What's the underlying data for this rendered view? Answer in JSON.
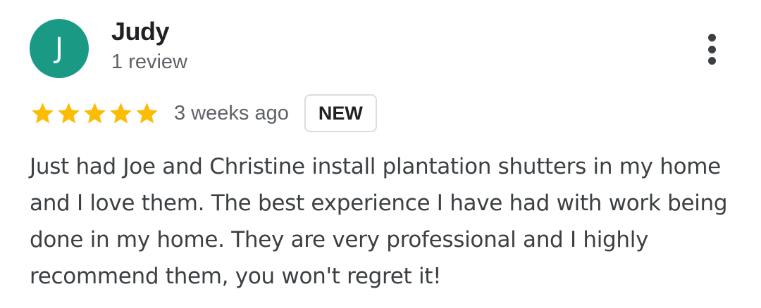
{
  "reviewer": {
    "initial": "J",
    "avatar_color": "#1a9a85",
    "name": "Judy",
    "review_count": "1 review"
  },
  "rating": {
    "stars": 5,
    "max_stars": 5,
    "star_color": "#fbbc04",
    "time_ago": "3 weeks ago",
    "badge": "NEW"
  },
  "review": {
    "text": "Just had Joe and Christine install plantation shutters in my home and I love them. The best experience I have had with work being done in my home. They are very professional and I highly recommend them, you won't regret it!"
  },
  "icons": {
    "more": "more-vert-icon",
    "star": "star-icon"
  }
}
